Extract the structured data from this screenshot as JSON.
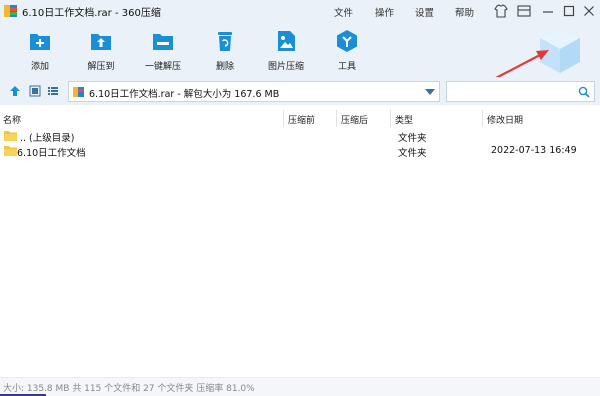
{
  "window": {
    "title": "6.10日工作文档.rar - 360压缩",
    "menu": [
      "文件",
      "操作",
      "设置",
      "帮助"
    ]
  },
  "toolbar": {
    "items": [
      {
        "label": "添加",
        "icon": "add-icon"
      },
      {
        "label": "解压到",
        "icon": "extract-to-icon"
      },
      {
        "label": "一键解压",
        "icon": "one-click-extract-icon"
      },
      {
        "label": "删除",
        "icon": "trash-icon"
      },
      {
        "label": "图片压缩",
        "icon": "image-compress-icon"
      },
      {
        "label": "工具",
        "icon": "tools-icon"
      }
    ]
  },
  "address": {
    "path": "6.10日工作文档.rar - 解包大小为 167.6 MB",
    "search_placeholder": ""
  },
  "columns": [
    "名称",
    "压缩前",
    "压缩后",
    "类型",
    "修改日期"
  ],
  "rows": [
    {
      "name": ".. (上级目录)",
      "before": "",
      "after": "",
      "type": "文件夹",
      "date": ""
    },
    {
      "name": "6.10日工作文档",
      "before": "",
      "after": "",
      "type": "文件夹",
      "date": "2022-07-13 16:49"
    }
  ],
  "status": {
    "text": "大小: 135.8 MB 共 115 个文件和 27 个文件夹 压缩率 81.0%"
  },
  "colors": {
    "accent": "#1a8fd6",
    "chrome": "#eaf1f8",
    "annotation_arrow": "#e53935"
  }
}
